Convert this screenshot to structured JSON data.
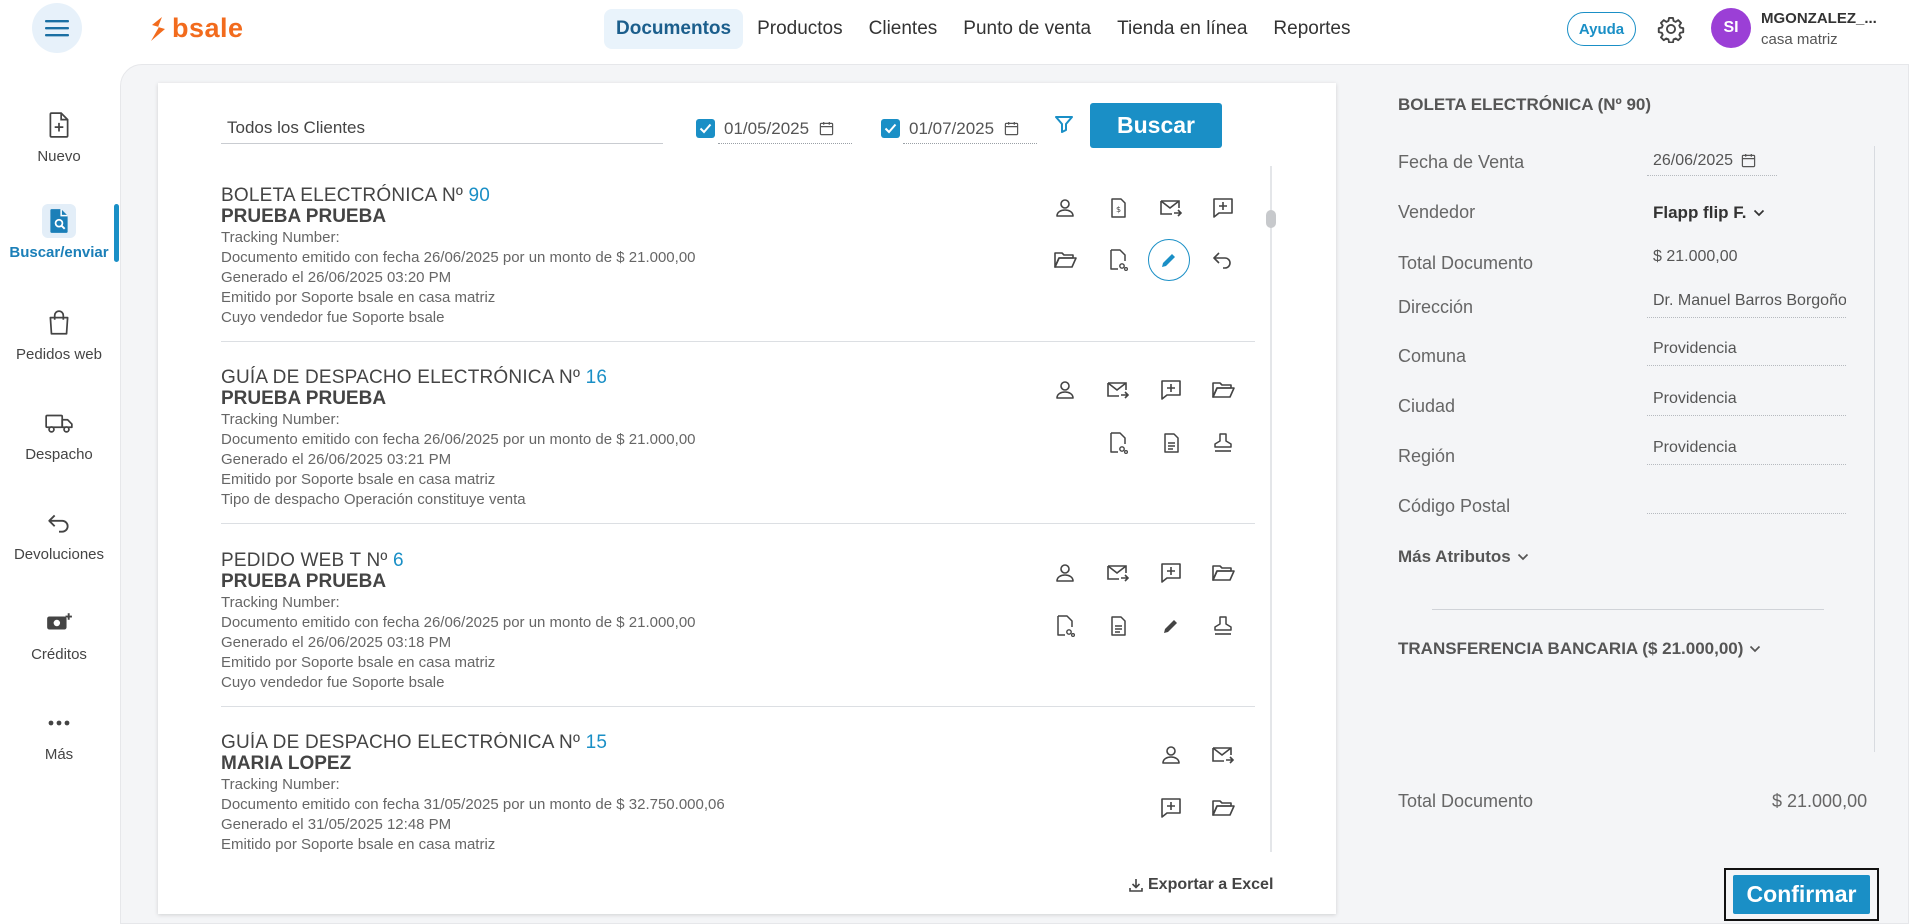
{
  "brand": {
    "logo_text": "bsale",
    "accent": "#1a8fc6",
    "logo_color": "#f26b1d"
  },
  "topnav": {
    "items": [
      "Documentos",
      "Productos",
      "Clientes",
      "Punto de venta",
      "Tienda en línea",
      "Reportes"
    ],
    "active": "Documentos",
    "help_label": "Ayuda",
    "user": {
      "initials": "SI",
      "name": "MGONZALEZ_...",
      "branch": "casa matriz",
      "avatar_color": "#9b3fd6"
    }
  },
  "sidebar": {
    "items": [
      {
        "label": "Nuevo",
        "icon": "file-plus-icon"
      },
      {
        "label": "Buscar/enviar",
        "icon": "file-search-icon",
        "active": true
      },
      {
        "label": "Pedidos web",
        "icon": "bag-icon"
      },
      {
        "label": "Despacho",
        "icon": "truck-icon"
      },
      {
        "label": "Devoluciones",
        "icon": "return-arrow-icon"
      },
      {
        "label": "Créditos",
        "icon": "cash-plus-icon"
      },
      {
        "label": "Más",
        "icon": "more-dots-icon"
      }
    ]
  },
  "filters": {
    "client": "Todos los Clientes",
    "date_from": "01/05/2025",
    "date_to": "01/07/2025",
    "search_label": "Buscar"
  },
  "documents": [
    {
      "title": "BOLETA ELECTRÓNICA Nº",
      "number": "90",
      "client": "PRUEBA PRUEBA",
      "lines": [
        "Tracking Number:",
        "Documento emitido con fecha 26/06/2025 por un monto de $ 21.000,00",
        "Generado el 26/06/2025 03:20 PM",
        "Emitido por Soporte bsale en casa matriz",
        "Cuyo vendedor fue Soporte bsale"
      ]
    },
    {
      "title": "GUÍA DE DESPACHO ELECTRÓNICA Nº",
      "number": "16",
      "client": "PRUEBA PRUEBA",
      "lines": [
        "Tracking Number:",
        "Documento emitido con fecha 26/06/2025 por un monto de $ 21.000,00",
        "Generado el 26/06/2025 03:21 PM",
        "Emitido por Soporte bsale en casa matriz",
        "Tipo de despacho Operación constituye venta"
      ]
    },
    {
      "title": "PEDIDO WEB T Nº",
      "number": "6",
      "client": "PRUEBA PRUEBA",
      "lines": [
        "Tracking Number:",
        "Documento emitido con fecha 26/06/2025 por un monto de $ 21.000,00",
        "Generado el 26/06/2025 03:18 PM",
        "Emitido por Soporte bsale en casa matriz",
        "Cuyo vendedor fue Soporte bsale"
      ]
    },
    {
      "title": "GUÍA DE DESPACHO ELECTRÓNICA Nº",
      "number": "15",
      "client": "MARIA LOPEZ",
      "lines": [
        "Tracking Number:",
        "Documento emitido con fecha 31/05/2025 por un monto de $ 32.750.000,06",
        "Generado el 31/05/2025 12:48 PM",
        "Emitido por Soporte bsale en casa matriz"
      ]
    }
  ],
  "export_label": "Exportar a Excel",
  "detail": {
    "title": "BOLETA ELECTRÓNICA (Nº 90)",
    "fields": {
      "fecha_venta": {
        "label": "Fecha de Venta",
        "value": "26/06/2025"
      },
      "vendedor": {
        "label": "Vendedor",
        "value": "Flapp flip F."
      },
      "total": {
        "label": "Total Documento",
        "value": "$ 21.000,00"
      },
      "direccion": {
        "label": "Dirección",
        "value": "Dr. Manuel Barros Borgoño"
      },
      "comuna": {
        "label": "Comuna",
        "value": "Providencia"
      },
      "ciudad": {
        "label": "Ciudad",
        "value": "Providencia"
      },
      "region": {
        "label": "Región",
        "value": "Providencia"
      },
      "codigo_postal": {
        "label": "Código Postal",
        "value": ""
      }
    },
    "more_attributes": "Más Atributos",
    "payment": "TRANSFERENCIA BANCARIA ($ 21.000,00)",
    "total_label": "Total Documento",
    "total_value": "$ 21.000,00",
    "confirm_label": "Confirmar"
  }
}
